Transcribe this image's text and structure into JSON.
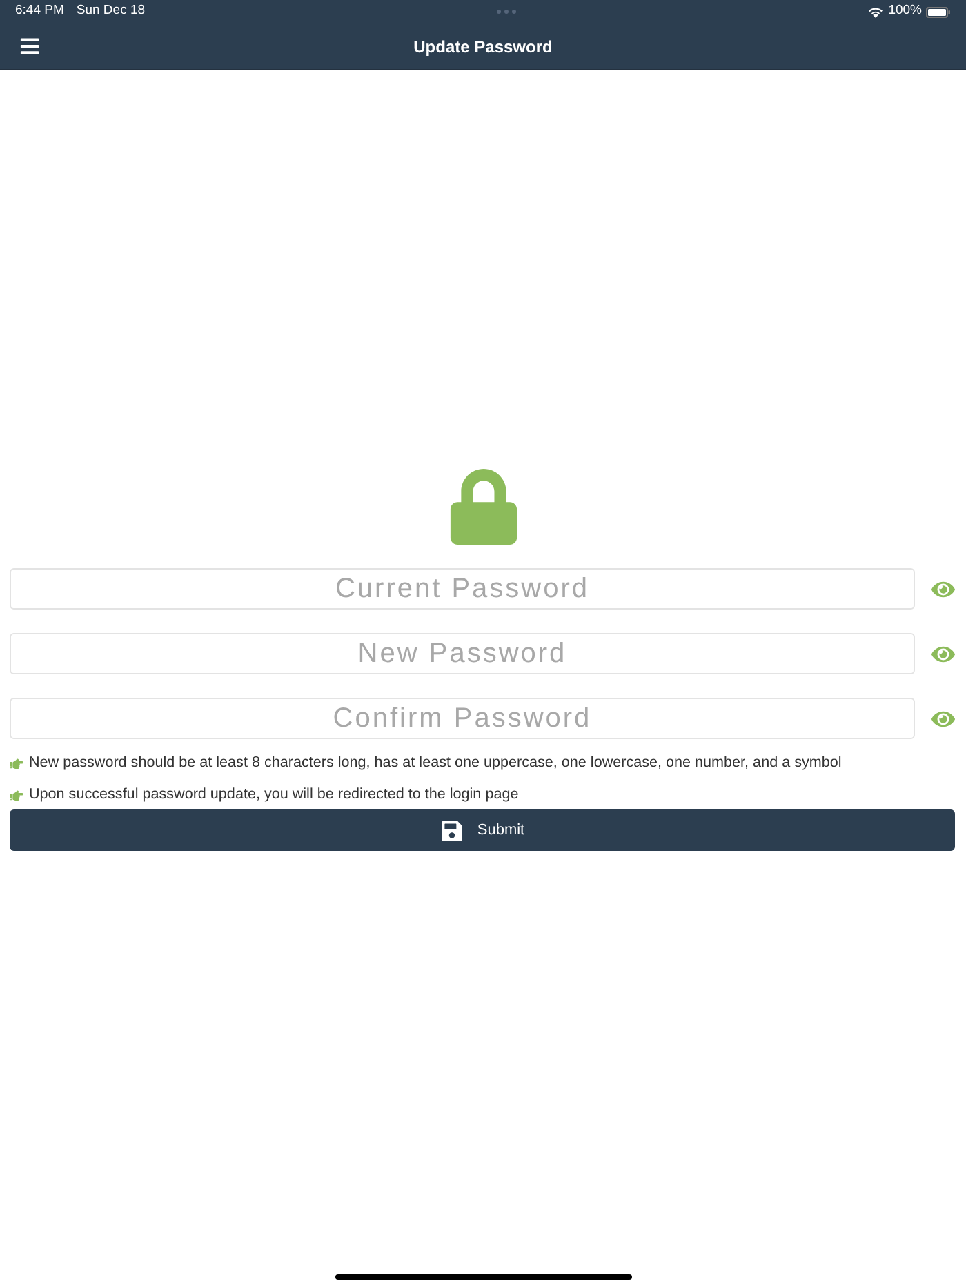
{
  "status_bar": {
    "time": "6:44 PM",
    "date": "Sun Dec 18",
    "battery": "100%"
  },
  "nav_bar": {
    "title": "Update Password"
  },
  "fields": [
    {
      "placeholder": "Current Password"
    },
    {
      "placeholder": "New Password"
    },
    {
      "placeholder": "Confirm Password"
    }
  ],
  "hints": [
    "New password should be at least 8 characters long, has at least one uppercase, one lowercase, one number, and a symbol",
    "Upon successful password update, you will be redirected to the login page"
  ],
  "submit_button": {
    "label": "Submit"
  }
}
